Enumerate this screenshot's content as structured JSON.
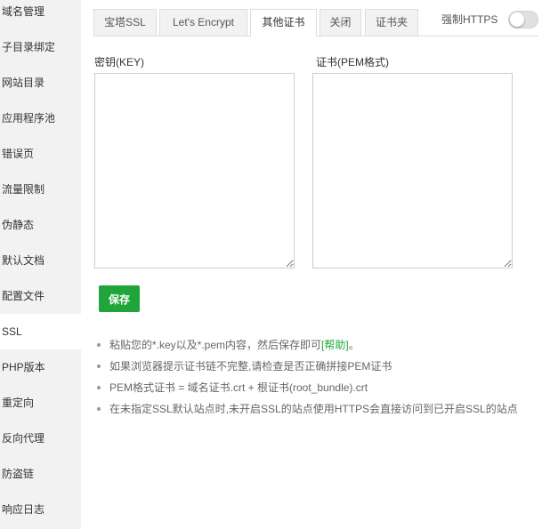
{
  "sidebar": {
    "items": [
      {
        "label": "域名管理"
      },
      {
        "label": "子目录绑定"
      },
      {
        "label": "网站目录"
      },
      {
        "label": "应用程序池"
      },
      {
        "label": "错误页"
      },
      {
        "label": "流量限制"
      },
      {
        "label": "伪静态"
      },
      {
        "label": "默认文档"
      },
      {
        "label": "配置文件"
      },
      {
        "label": "SSL"
      },
      {
        "label": "PHP版本"
      },
      {
        "label": "重定向"
      },
      {
        "label": "反向代理"
      },
      {
        "label": "防盗链"
      },
      {
        "label": "响应日志"
      }
    ],
    "active": "SSL"
  },
  "tabs": [
    {
      "label": "宝塔SSL"
    },
    {
      "label": "Let's Encrypt"
    },
    {
      "label": "其他证书"
    },
    {
      "label": "关闭"
    },
    {
      "label": "证书夹"
    }
  ],
  "active_tab": "其他证书",
  "force_https": {
    "label": "强制HTTPS",
    "enabled": false
  },
  "key_field": {
    "label": "密钥(KEY)",
    "value": ""
  },
  "cert_field": {
    "label": "证书(PEM格式)",
    "value": ""
  },
  "save_label": "保存",
  "notes": {
    "note1_text": "粘贴您的*.key以及*.pem内容，然后保存即可",
    "help_link": "[帮助]",
    "note1_end": "。",
    "note2": "如果浏览器提示证书链不完整,请检查是否正确拼接PEM证书",
    "note3": "PEM格式证书 = 域名证书.crt + 根证书(root_bundle).crt",
    "note4": "在未指定SSL默认站点时,未开启SSL的站点使用HTTPS会直接访问到已开启SSL的站点"
  },
  "colors": {
    "accent": "#20a53a",
    "sidebar_bg": "#f2f2f2",
    "border": "#dddddd"
  }
}
